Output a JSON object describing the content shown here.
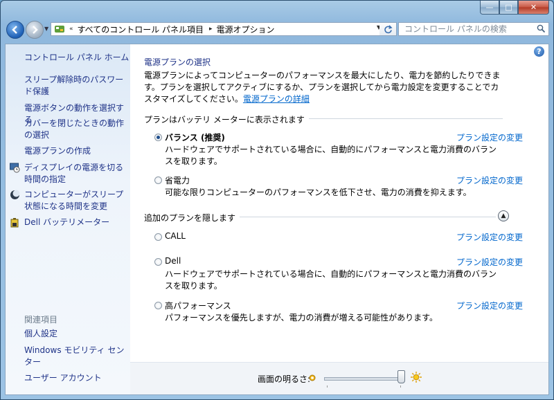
{
  "address": {
    "seg1": "すべてのコントロール パネル項目",
    "seg2": "電源オプション",
    "chevron_left": "«",
    "chevron_mid": "▸"
  },
  "search": {
    "placeholder": "コントロール パネルの検索"
  },
  "sidebar": {
    "home": "コントロール パネル ホーム",
    "items": [
      "スリープ解除時のパスワード保護",
      "電源ボタンの動作を選択する",
      "カバーを閉じたときの動作の選択",
      "電源プランの作成",
      "ディスプレイの電源を切る時間の指定",
      "コンピューターがスリープ状態になる時間を変更",
      "Dell バッテリメーター"
    ],
    "related_heading": "関連項目",
    "related": [
      "個人設定",
      "Windows モビリティ センター",
      "ユーザー アカウント"
    ]
  },
  "content": {
    "heading": "電源プランの選択",
    "intro": "電源プランによってコンピューターのパフォーマンスを最大にしたり、電力を節約したりできます。プランを選択してアクティブにするか、プランを選択してから電力設定を変更することでカスタマイズしてください。",
    "intro_link": "電源プランの詳細",
    "group1_title": "プランはバッテリ メーターに表示されます",
    "group2_title": "追加のプランを隠します",
    "change_link": "プラン設定の変更",
    "plans": [
      {
        "name": "バランス (推奨)",
        "desc": "ハードウェアでサポートされている場合に、自動的にパフォーマンスと電力消費のバランスを取ります。",
        "selected": true
      },
      {
        "name": "省電力",
        "desc": "可能な限りコンピューターのパフォーマンスを低下させ、電力の消費を抑えます。",
        "selected": false
      },
      {
        "name": "CALL",
        "desc": "",
        "selected": false
      },
      {
        "name": "Dell",
        "desc": "ハードウェアでサポートされている場合に、自動的にパフォーマンスと電力消費のバランスを取ります。",
        "selected": false
      },
      {
        "name": "高パフォーマンス",
        "desc": "パフォーマンスを優先しますが、電力の消費が増える可能性があります。",
        "selected": false
      }
    ]
  },
  "footer": {
    "brightness_label": "画面の明るさ:",
    "brightness_level": 1.0
  },
  "window_buttons": {
    "min": "—",
    "max": "□",
    "close": "✕"
  },
  "help": "?"
}
